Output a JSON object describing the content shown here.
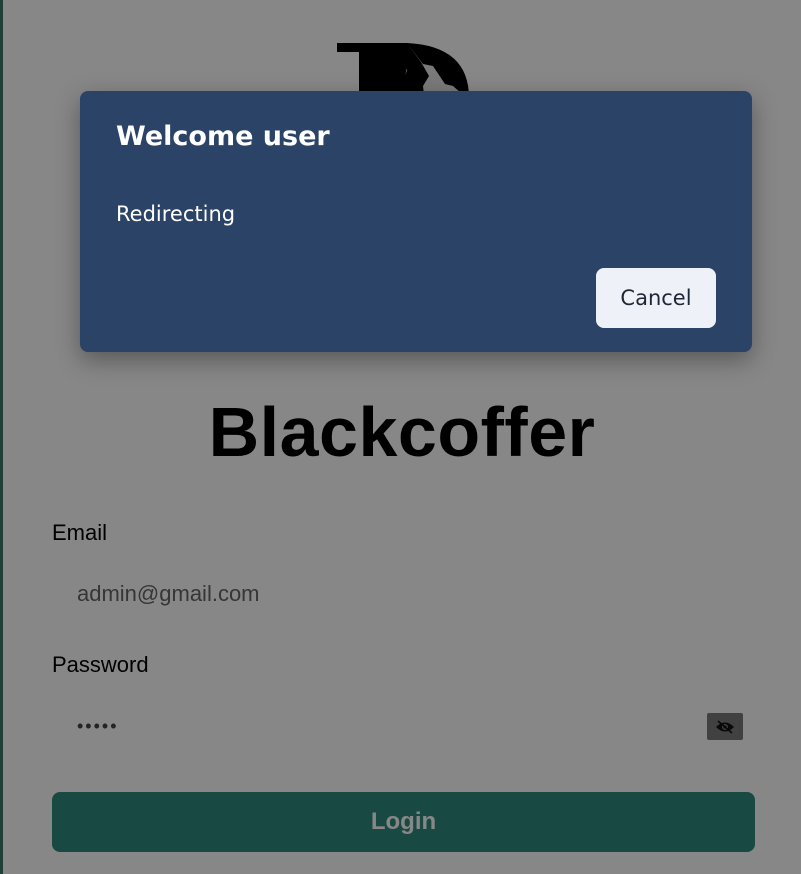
{
  "brand": {
    "name": "Blackcoffer"
  },
  "login_form": {
    "email_label": "Email",
    "email_placeholder": "admin@gmail.com",
    "password_label": "Password",
    "password_value": "•••••",
    "password_toggle_icon": "eye-slash-icon",
    "login_label": "Login"
  },
  "modal": {
    "title": "Welcome user",
    "message": "Redirecting",
    "cancel_label": "Cancel"
  },
  "colors": {
    "modal_background": "#2a4366",
    "login_button": "#2e8a7d",
    "cancel_button": "#eef2f8"
  }
}
